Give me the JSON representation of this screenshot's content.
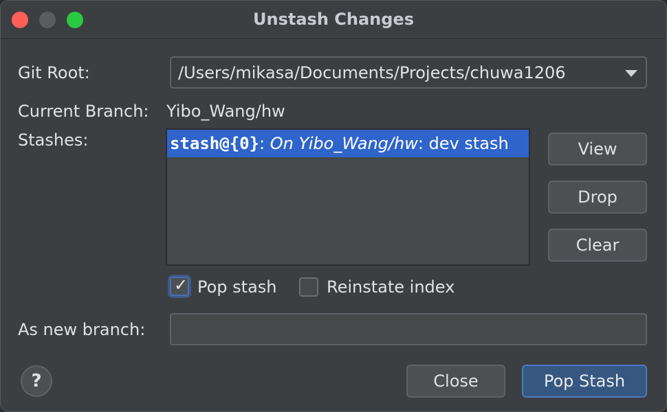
{
  "window": {
    "title": "Unstash Changes"
  },
  "git_root": {
    "label": "Git Root:",
    "value": "/Users/mikasa/Documents/Projects/chuwa1206"
  },
  "current_branch": {
    "label": "Current Branch:",
    "value": "Yibo_Wang/hw"
  },
  "stashes": {
    "label": "Stashes:",
    "items": [
      {
        "ref": "stash@{0}",
        "sep1": ": ",
        "on": "On Yibo_Wang/hw",
        "sep2": ": ",
        "message": "dev stash",
        "selected": true
      }
    ]
  },
  "buttons": {
    "view": "View",
    "drop": "Drop",
    "clear": "Clear",
    "close": "Close",
    "pop_stash": "Pop Stash",
    "help": "?"
  },
  "options": {
    "pop_stash_label": "Pop stash",
    "pop_stash_checked": true,
    "reinstate_index_label": "Reinstate index",
    "reinstate_index_checked": false
  },
  "new_branch": {
    "label": "As new branch:",
    "value": ""
  },
  "colors": {
    "selection": "#2f65ca",
    "default_button": "#365880",
    "close_dot": "#ff5f57",
    "zoom_dot": "#28c840"
  }
}
